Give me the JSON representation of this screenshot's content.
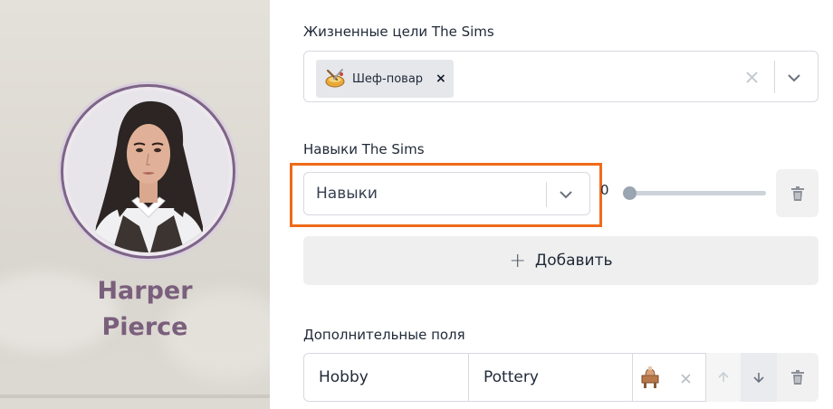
{
  "profile": {
    "first_name": "Harper",
    "last_name": "Pierce",
    "avatar_icon": "sim-portrait-avatar"
  },
  "aspirations": {
    "label": "Жизненные цели The Sims",
    "chip_label": "Шеф-повар",
    "chip_icon": "chef-aspiration-icon",
    "chip_remove": "×",
    "clear_icon": "clear-x-icon",
    "dropdown_icon": "chevron-down-icon"
  },
  "skills": {
    "label": "Навыки The Sims",
    "select_placeholder": "Навыки",
    "slider_value": "0",
    "slider_level": 0,
    "delete_icon": "trash-icon"
  },
  "add_button": {
    "plus": "+",
    "label": "Добавить"
  },
  "custom_fields": {
    "label": "Дополнительные поля",
    "rows": [
      {
        "key": "Hobby",
        "value": "Pottery",
        "image_icon": "pottery-wheel-icon"
      }
    ],
    "clear_icon": "clear-x-icon",
    "move_up_icon": "arrow-up-icon",
    "move_down_icon": "arrow-down-icon",
    "delete_icon": "trash-icon"
  },
  "colors": {
    "highlight": "#ef6a1a",
    "name_color": "#7a5f7c",
    "avatar_ring": "#7e6488"
  }
}
